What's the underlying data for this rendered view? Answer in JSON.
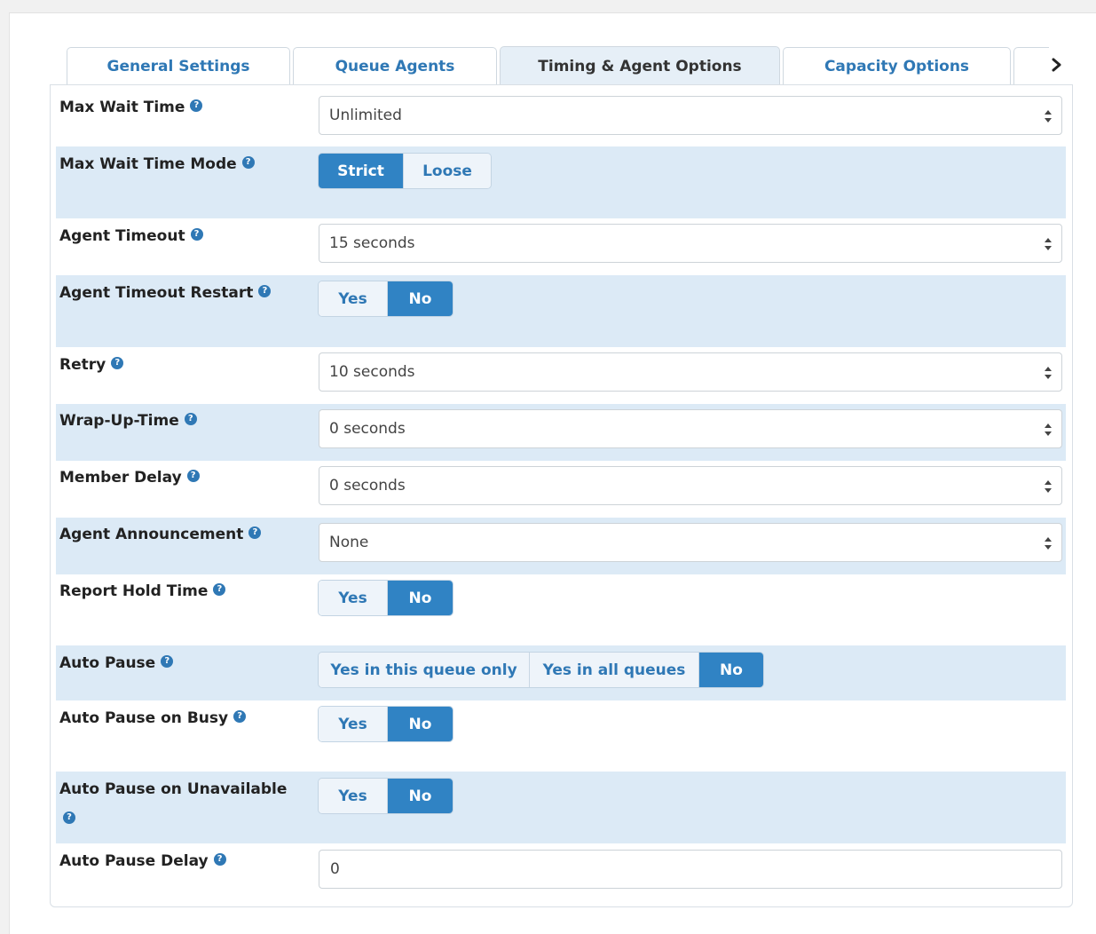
{
  "tabs": [
    {
      "label": "General Settings"
    },
    {
      "label": "Queue Agents"
    },
    {
      "label": "Timing & Agent Options"
    },
    {
      "label": "Capacity Options"
    }
  ],
  "icons": {
    "next": "chevron-right-icon",
    "help": "question-circle-icon",
    "select_caret": "sort-caret-icon"
  },
  "colors": {
    "accent": "#3083c4",
    "link": "#2f78b5",
    "row_shade": "#dceaf6"
  },
  "fields": {
    "max_wait_time": {
      "label": "Max Wait Time",
      "value": "Unlimited"
    },
    "max_wait_time_mode": {
      "label": "Max Wait Time Mode",
      "options": [
        "Strict",
        "Loose"
      ],
      "selected": "Strict"
    },
    "agent_timeout": {
      "label": "Agent Timeout",
      "value": "15 seconds"
    },
    "agent_timeout_restart": {
      "label": "Agent Timeout Restart",
      "options": [
        "Yes",
        "No"
      ],
      "selected": "No"
    },
    "retry": {
      "label": "Retry",
      "value": "10 seconds"
    },
    "wrap_up_time": {
      "label": "Wrap-Up-Time",
      "value": "0 seconds"
    },
    "member_delay": {
      "label": "Member Delay",
      "value": "0 seconds"
    },
    "agent_announcement": {
      "label": "Agent Announcement",
      "value": "None"
    },
    "report_hold_time": {
      "label": "Report Hold Time",
      "options": [
        "Yes",
        "No"
      ],
      "selected": "No"
    },
    "auto_pause": {
      "label": "Auto Pause",
      "options": [
        "Yes in this queue only",
        "Yes in all queues",
        "No"
      ],
      "selected": "No"
    },
    "auto_pause_on_busy": {
      "label": "Auto Pause on Busy",
      "options": [
        "Yes",
        "No"
      ],
      "selected": "No"
    },
    "auto_pause_on_unavailable": {
      "label": "Auto Pause on Unavailable",
      "options": [
        "Yes",
        "No"
      ],
      "selected": "No"
    },
    "auto_pause_delay": {
      "label": "Auto Pause Delay",
      "value": "0"
    }
  },
  "help_glyph": "?"
}
